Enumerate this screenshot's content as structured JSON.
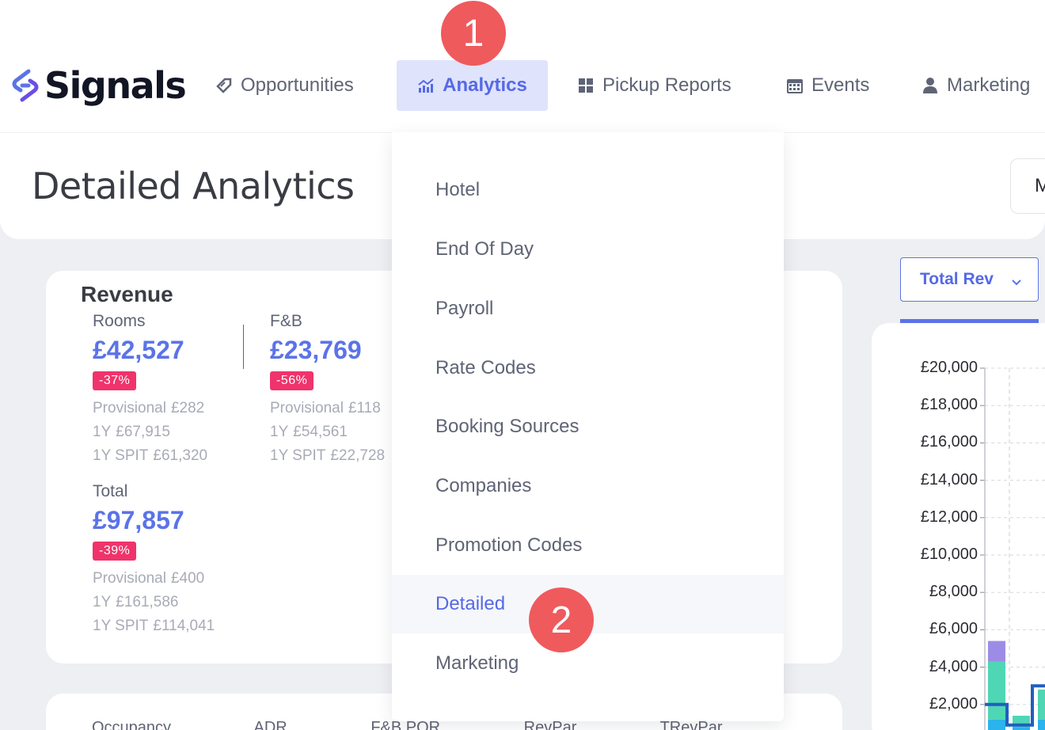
{
  "brand": {
    "name": "Signals"
  },
  "nav": {
    "items": [
      {
        "label": "Opportunities",
        "icon": "tag-icon"
      },
      {
        "label": "Analytics",
        "icon": "chart-icon",
        "active": true
      },
      {
        "label": "Pickup Reports",
        "icon": "grid-icon"
      },
      {
        "label": "Events",
        "icon": "calendar-icon"
      },
      {
        "label": "Marketing",
        "icon": "user-icon"
      }
    ]
  },
  "annotations": {
    "step1": "1",
    "step2": "2"
  },
  "page": {
    "title": "Detailed Analytics",
    "right_button_label": "M"
  },
  "revenue": {
    "title": "Revenue",
    "rooms": {
      "label": "Rooms",
      "value": "£42,527",
      "change": "-37%",
      "provisional_label": "Provisional",
      "provisional": "£282",
      "ly_label": "1Y",
      "ly": "£67,915",
      "spit_label": "1Y SPIT",
      "spit": "£61,320"
    },
    "fb": {
      "label": "F&B",
      "value": "£23,769",
      "change": "-56%",
      "provisional_label": "Provisional",
      "provisional": "£118",
      "ly_label": "1Y",
      "ly": "£54,561",
      "spit_label": "1Y SPIT",
      "spit": "£22,728"
    },
    "total": {
      "label": "Total",
      "value": "£97,857",
      "change": "-39%",
      "provisional_label": "Provisional",
      "provisional": "£400",
      "ly_label": "1Y",
      "ly": "£161,586",
      "spit_label": "1Y SPIT",
      "spit": "£114,041"
    }
  },
  "bottom_metrics": [
    "Occupancy",
    "ADR",
    "F&B POR",
    "RevPar",
    "TRevPar"
  ],
  "dropdown": {
    "items": [
      {
        "label": "Hotel"
      },
      {
        "label": "End Of Day"
      },
      {
        "label": "Payroll"
      },
      {
        "label": "Rate Codes"
      },
      {
        "label": "Booking Sources"
      },
      {
        "label": "Companies"
      },
      {
        "label": "Promotion Codes"
      },
      {
        "label": "Detailed",
        "active": true
      },
      {
        "label": "Marketing"
      }
    ]
  },
  "chart_control": {
    "selected": "Total Rev"
  },
  "colors": {
    "accent": "#5b73e8",
    "negative_badge": "#f0336b",
    "annotation": "#ef5a5d",
    "bar_purple": "#9d8ce6",
    "bar_teal": "#4fd6b4",
    "bar_blue": "#2ab3ec",
    "line": "#1f5fbf"
  },
  "chart_data": {
    "type": "bar",
    "y_ticks": [
      "£20,000",
      "£18,000",
      "£16,000",
      "£14,000",
      "£12,000",
      "£10,000",
      "£8,000",
      "£6,000",
      "£4,000",
      "£2,000"
    ],
    "ylim": [
      0,
      20000
    ],
    "grid": true
  }
}
